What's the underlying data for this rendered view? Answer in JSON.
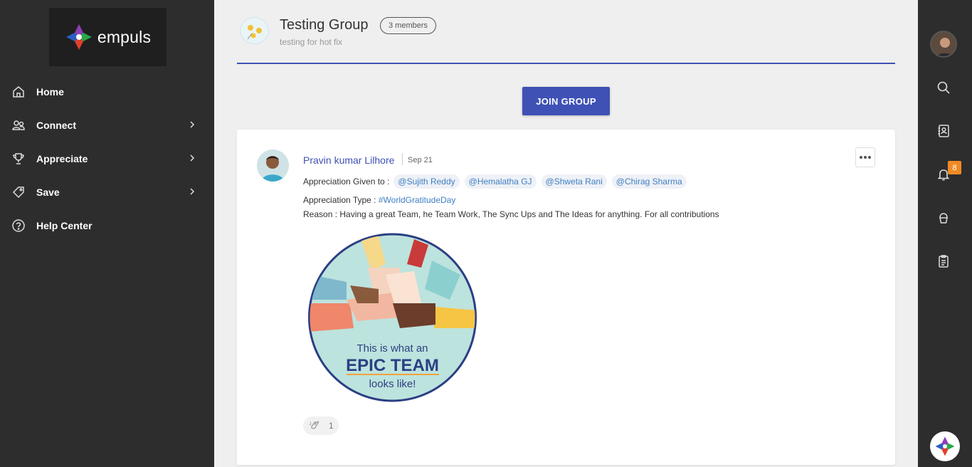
{
  "brand": {
    "name": "empuls"
  },
  "sidebar": {
    "items": [
      {
        "label": "Home",
        "icon": "home-icon",
        "has_submenu": false
      },
      {
        "label": "Connect",
        "icon": "people-icon",
        "has_submenu": true
      },
      {
        "label": "Appreciate",
        "icon": "trophy-icon",
        "has_submenu": true
      },
      {
        "label": "Save",
        "icon": "tag-icon",
        "has_submenu": true
      },
      {
        "label": "Help Center",
        "icon": "help-icon",
        "has_submenu": false
      }
    ]
  },
  "group": {
    "title": "Testing Group",
    "members_badge": "3 members",
    "description": "testing for hot fix",
    "join_label": "JOIN GROUP"
  },
  "post": {
    "author": "Pravin kumar Lilhore",
    "date": "Sep 21",
    "given_to_label": "Appreciation Given to :",
    "recipients": [
      "@Sujith Reddy",
      "@Hemalatha GJ",
      "@Shweta Rani",
      "@Chirag Sharma"
    ],
    "type_label": "Appreciation Type :",
    "type_value": "#WorldGratitudeDay",
    "reason": "Reason : Having a great Team, he Team Work, The Sync Ups and The Ideas for anything.  For all contributions",
    "image": {
      "line1": "This is what an",
      "line2": "EPIC TEAM",
      "line3": "looks like!"
    },
    "clap_count": "1"
  },
  "right_rail": {
    "items": [
      "search-icon",
      "contacts-icon",
      "bell-icon",
      "cupcake-icon",
      "clipboard-icon"
    ],
    "notification_count": "8"
  },
  "colors": {
    "sidebar_bg": "#2d2d2d",
    "accent": "#3f51b5",
    "link": "#3f7fc4",
    "badge": "#f08a24"
  }
}
